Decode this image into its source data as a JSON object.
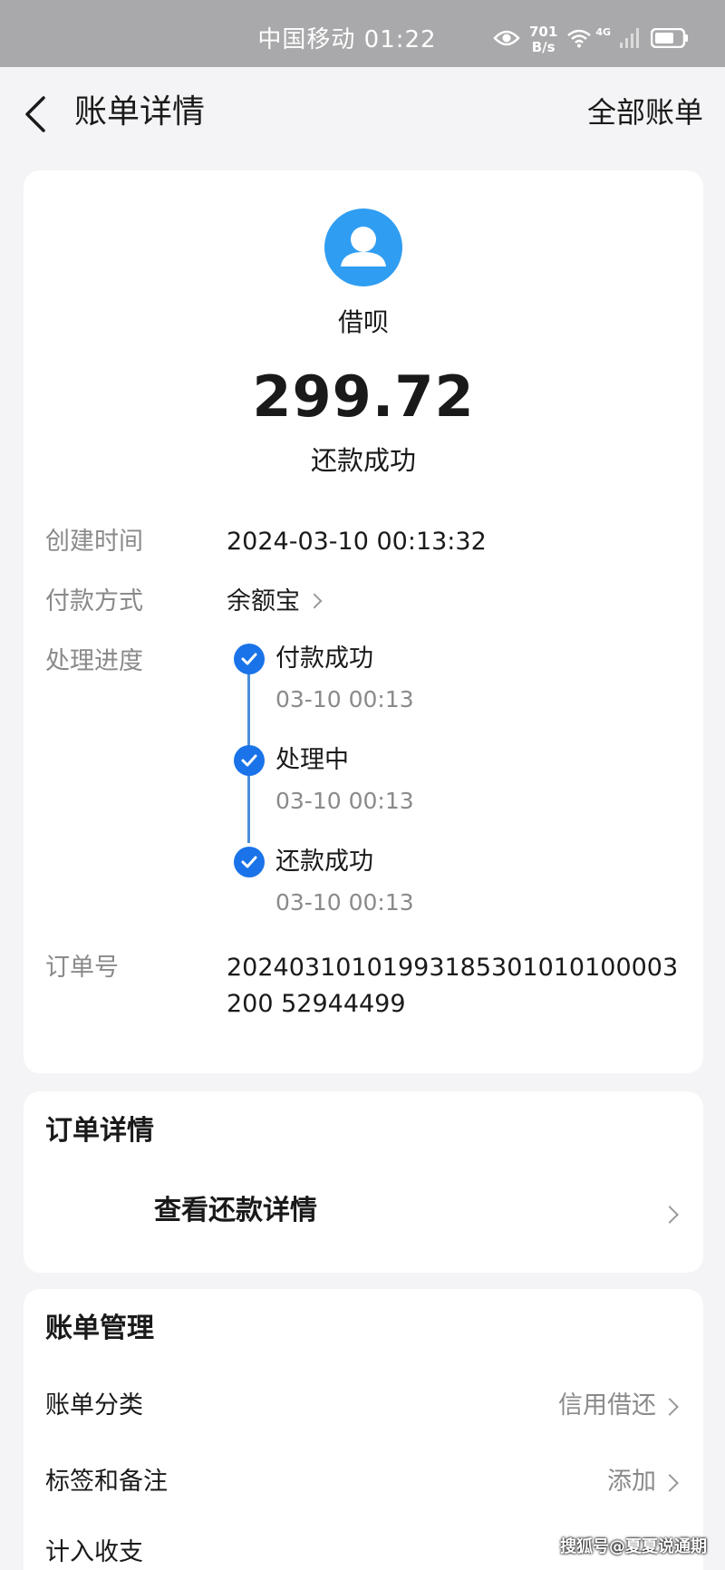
{
  "status_bar": {
    "carrier_time": "中国移动 01:22",
    "speed_value": "701",
    "speed_unit": "B/s",
    "network": "4G"
  },
  "nav": {
    "title": "账单详情",
    "right_action": "全部账单"
  },
  "bill": {
    "merchant": "借呗",
    "amount": "299.72",
    "status": "还款成功",
    "created_label": "创建时间",
    "created_value": "2024-03-10 00:13:32",
    "payment_label": "付款方式",
    "payment_value": "余额宝",
    "progress_label": "处理进度",
    "progress": [
      {
        "name": "付款成功",
        "time": "03-10 00:13"
      },
      {
        "name": "处理中",
        "time": "03-10 00:13"
      },
      {
        "name": "还款成功",
        "time": "03-10 00:13"
      }
    ],
    "order_label": "订单号",
    "order_value": "20240310101993185301010100003200 52944499"
  },
  "order_detail": {
    "title": "订单详情",
    "link": "查看还款详情"
  },
  "management": {
    "title": "账单管理",
    "rows": [
      {
        "label": "账单分类",
        "value": "信用借还"
      },
      {
        "label": "标签和备注",
        "value": "添加"
      },
      {
        "label": "计入收支",
        "value": ""
      }
    ]
  },
  "watermark": "搜狐号@夏夏说通期",
  "colors": {
    "accent": "#1a73e8",
    "avatar": "#2f9df1",
    "status_bar": "#a9a9ab"
  }
}
